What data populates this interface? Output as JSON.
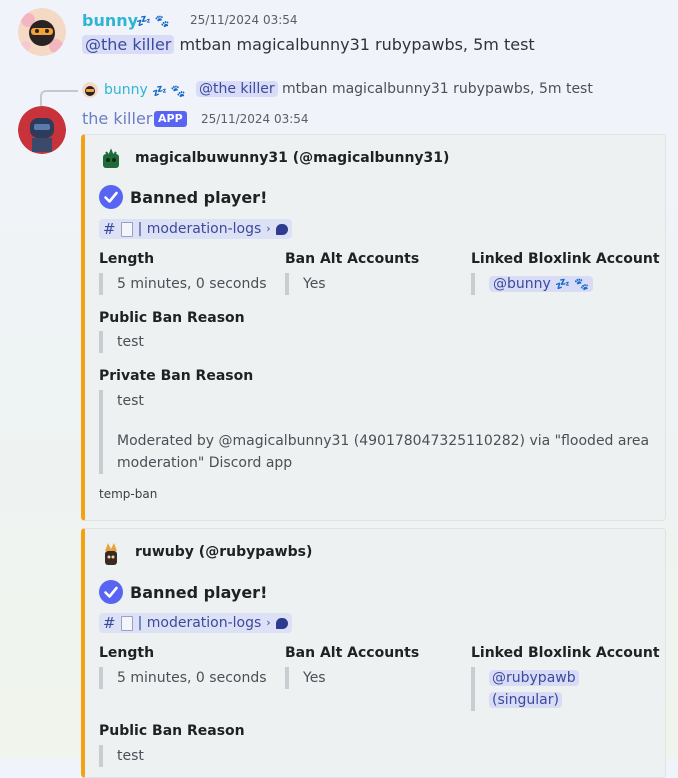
{
  "msg1": {
    "author": "bunny",
    "author_emoji": "💤 🐾",
    "timestamp": "25/11/2024 03:54",
    "mention": "@the killer",
    "text": "mtban magicalbunny31 rubypawbs, 5m test"
  },
  "reply": {
    "author": "bunny",
    "author_emoji": "💤 🐾",
    "mention": "@the killer",
    "text": "mtban magicalbunny31 rubypawbs, 5m test"
  },
  "msg2": {
    "author": "the killer",
    "badge": "APP",
    "timestamp": "25/11/2024 03:54"
  },
  "embeds": [
    {
      "author": "magicalbuwunny31 (@magicalbunny31)",
      "title": "Banned player!",
      "channel": "| moderation-logs",
      "fields": {
        "length_label": "Length",
        "length_value": "5 minutes, 0 seconds",
        "alt_label": "Ban Alt Accounts",
        "alt_value": "Yes",
        "linked_label": "Linked Bloxlink Account",
        "linked_value": "@bunny",
        "linked_emoji": "💤 🐾",
        "public_label": "Public Ban Reason",
        "public_value": "test",
        "private_label": "Private Ban Reason",
        "private_value": "test",
        "private_note_1": "Moderated by @magicalbunny31 (490178047325110282) via \"flooded area",
        "private_note_2": "moderation\" Discord app"
      },
      "footer": "temp-ban"
    },
    {
      "author": "ruwuby (@rubypawbs)",
      "title": "Banned player!",
      "channel": "| moderation-logs",
      "fields": {
        "length_label": "Length",
        "length_value": "5 minutes, 0 seconds",
        "alt_label": "Ban Alt Accounts",
        "alt_value": "Yes",
        "linked_label": "Linked Bloxlink Account",
        "linked_value_1": "@rubypawb",
        "linked_value_2": "(singular)",
        "public_label": "Public Ban Reason",
        "public_value": "test"
      }
    }
  ],
  "colors": {
    "embed_accent": "#f5a114",
    "username_bunny": "#2fb5d4",
    "username_killer": "#6b7ec4",
    "check_blue": "#5865f2"
  }
}
